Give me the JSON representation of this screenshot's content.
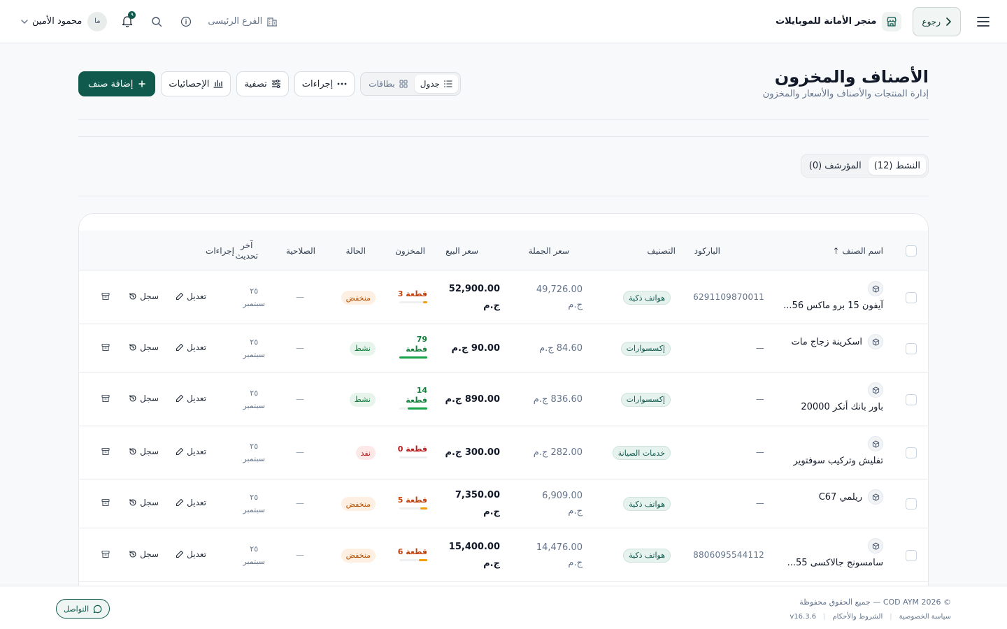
{
  "topbar": {
    "back_label": "رجوع",
    "store_name": "متجر الأمانة للموبايلات",
    "branch_label": "الفرع الرئيسى",
    "user_initials": "ما",
    "user_name": "محمود الأمين",
    "notification_count": "٩"
  },
  "header": {
    "title": "الأصناف والمخزون",
    "subtitle": "إدارة المنتجات والأصناف والأسعار والمخزون"
  },
  "toolbar": {
    "view_table": "جدول",
    "view_cards": "بطاقات",
    "actions": "إجراءات",
    "filter": "تصفية",
    "stats": "الإحصائيات",
    "add_item": "إضافة صنف"
  },
  "status_tabs": {
    "active": "النشط (12)",
    "archived": "المؤرشف (0)"
  },
  "table": {
    "columns": {
      "name": "اسم الصنف ↑",
      "barcode": "الباركود",
      "category": "التصنيف",
      "wholesale": "سعر الجملة",
      "sale": "سعر البيع",
      "stock": "المخزون",
      "status": "الحالة",
      "validity": "الصلاحية",
      "updated_1": "آخر",
      "updated_2": "تحديث",
      "actions": "إجراءات"
    },
    "edit_label": "تعديل",
    "log_label": "سجل",
    "rows": [
      {
        "name_1": "",
        "name_2": "آيفون 15 برو ماكس 56...",
        "barcode": "6291109870011",
        "category": "هواتف ذكية",
        "wholesale_1": "49,726.00",
        "wholesale_2": "ج.م",
        "sale_1": "52,900.00",
        "sale_2": "ج.م",
        "stock_1": "قطعة 3",
        "stock_2": "",
        "stock_level": 0.15,
        "stock_color": "#f59e0b",
        "stock_text_color": "#c2410c",
        "status": "منخفض",
        "status_kind": "low",
        "validity": "—",
        "upd_1": "٢٥",
        "upd_2": "سبتمبر"
      },
      {
        "name_1": "اسكرينة زجاج مات",
        "name_2": "",
        "barcode": "—",
        "category": "إكسسوارات",
        "wholesale_1": "84.60 ج.م",
        "wholesale_2": "",
        "sale_1": "90.00 ج.م",
        "sale_2": "",
        "stock_1": "79",
        "stock_2": "قطعة",
        "stock_level": 1.0,
        "stock_color": "#16a34a",
        "stock_text_color": "#15803d",
        "status": "نشط",
        "status_kind": "ok",
        "validity": "—",
        "upd_1": "٢٥",
        "upd_2": "سبتمبر"
      },
      {
        "name_1": "",
        "name_2": "باور بانك أنكر 20000",
        "barcode": "—",
        "category": "إكسسوارات",
        "wholesale_1": "836.60 ج.م",
        "wholesale_2": "",
        "sale_1": "890.00 ج.م",
        "sale_2": "",
        "stock_1": "14",
        "stock_2": "قطعة",
        "stock_level": 0.7,
        "stock_color": "#16a34a",
        "stock_text_color": "#15803d",
        "status": "نشط",
        "status_kind": "ok",
        "validity": "—",
        "upd_1": "٢٥",
        "upd_2": "سبتمبر"
      },
      {
        "name_1": "",
        "name_2": "تفليش وتركيب سوفتوير",
        "barcode": "—",
        "category": "خدمات الصيانة",
        "wholesale_1": "282.00 ج.م",
        "wholesale_2": "",
        "sale_1": "300.00 ج.م",
        "sale_2": "",
        "stock_1": "قطعة 0",
        "stock_2": "",
        "stock_level": 0.0,
        "stock_color": "#ef4444",
        "stock_text_color": "#b91c1c",
        "status": "نفد",
        "status_kind": "out",
        "validity": "—",
        "upd_1": "٢٥",
        "upd_2": "سبتمبر"
      },
      {
        "name_1": "ريلمي C67",
        "name_2": "",
        "barcode": "—",
        "category": "هواتف ذكية",
        "wholesale_1": "6,909.00",
        "wholesale_2": "ج.م",
        "sale_1": "7,350.00",
        "sale_2": "ج.م",
        "stock_1": "قطعة 5",
        "stock_2": "",
        "stock_level": 0.25,
        "stock_color": "#f59e0b",
        "stock_text_color": "#c2410c",
        "status": "منخفض",
        "status_kind": "low",
        "validity": "—",
        "upd_1": "٢٥",
        "upd_2": "سبتمبر"
      },
      {
        "name_1": "",
        "name_2": "سامسونج جالاكسى 55...",
        "barcode": "8806095544112",
        "category": "هواتف ذكية",
        "wholesale_1": "14,476.00",
        "wholesale_2": "ج.م",
        "sale_1": "15,400.00",
        "sale_2": "ج.م",
        "stock_1": "قطعة 6",
        "stock_2": "",
        "stock_level": 0.3,
        "stock_color": "#f59e0b",
        "stock_text_color": "#c2410c",
        "status": "منخفض",
        "status_kind": "low",
        "validity": "—",
        "upd_1": "٢٥",
        "upd_2": "سبتمبر"
      }
    ]
  },
  "footer": {
    "copyright": "© 2026 COD AYM — جميع الحقوق محفوظة",
    "privacy": "سياسة الخصوصية",
    "terms": "الشروط والأحكام",
    "version": "v16.3.6",
    "contact": "التواصل"
  },
  "colors": {
    "accent": "#0f5a4d",
    "background": "#f8f9fa"
  }
}
